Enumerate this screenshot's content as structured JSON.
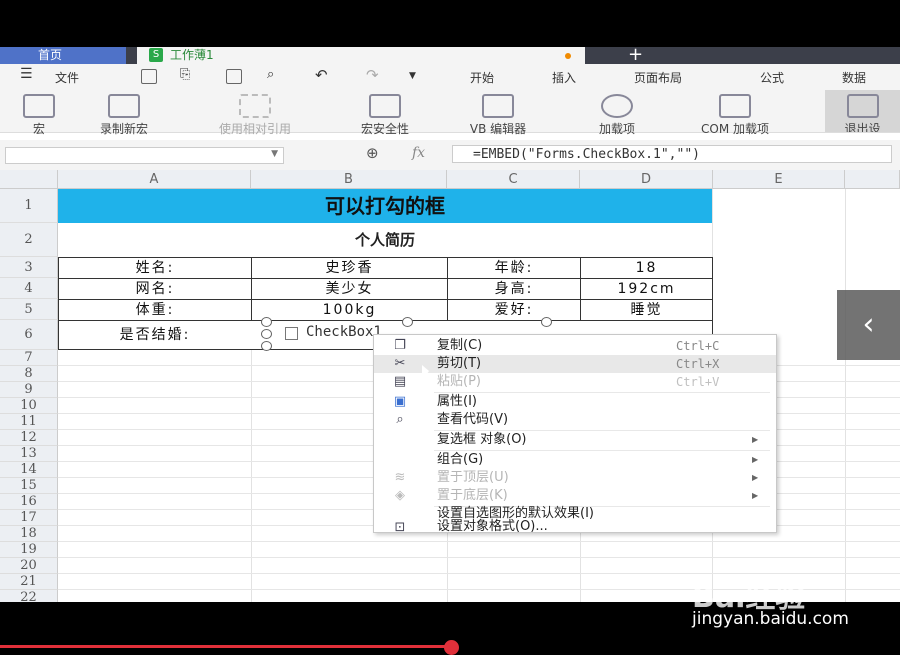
{
  "tabs": {
    "home": "首页",
    "doc_icon": "S",
    "doc": "工作薄1",
    "plus": "+"
  },
  "menu": {
    "file": "文件",
    "items": [
      "开始",
      "插入",
      "页面布局",
      "公式",
      "数据"
    ]
  },
  "ribbon": {
    "buttons": [
      "宏",
      "录制新宏",
      "使用相对引用",
      "宏安全性",
      "VB 编辑器",
      "加载项",
      "COM 加载项",
      "退出设"
    ]
  },
  "formula_bar": {
    "fx": "fx",
    "formula": "=EMBED(\"Forms.CheckBox.1\",\"\")"
  },
  "columns": [
    "A",
    "B",
    "C",
    "D",
    "E"
  ],
  "rows": [
    "1",
    "2",
    "3",
    "4",
    "5",
    "6",
    "7",
    "8",
    "9",
    "10",
    "11",
    "12",
    "13",
    "14",
    "15",
    "16",
    "17",
    "18",
    "19",
    "20",
    "21",
    "22"
  ],
  "sheet": {
    "title": "可以打勾的框",
    "subtitle": "个人简历",
    "r3": {
      "a": "姓名:",
      "b": "史珍香",
      "c": "年龄:",
      "d": "18"
    },
    "r4": {
      "a": "网名:",
      "b": "美少女",
      "c": "身高:",
      "d": "192cm"
    },
    "r5": {
      "a": "体重:",
      "b": "100kg",
      "c": "爱好:",
      "d": "睡觉"
    },
    "r6": {
      "a": "是否结婚:",
      "checkbox": "CheckBox1"
    }
  },
  "context_menu": {
    "copy": {
      "label": "复制(C)",
      "shortcut": "Ctrl+C"
    },
    "cut": {
      "label": "剪切(T)",
      "shortcut": "Ctrl+X"
    },
    "paste": {
      "label": "粘贴(P)",
      "shortcut": "Ctrl+V"
    },
    "properties": {
      "label": "属性(I)"
    },
    "view_code": {
      "label": "查看代码(V)"
    },
    "checkbox_object": {
      "label": "复选框 对象(O)"
    },
    "group": {
      "label": "组合(G)"
    },
    "bring_front": {
      "label": "置于顶层(U)"
    },
    "send_back": {
      "label": "置于底层(K)"
    },
    "set_default": {
      "label": "设置自选图形的默认效果(I)"
    },
    "format_object": {
      "label": "设置对象格式(O)..."
    }
  },
  "watermark": {
    "logo": "Bai经验",
    "url": "jingyan.baidu.com"
  },
  "colors": {
    "title_fill": "#1fb2ea",
    "tab_home": "#4f72c8",
    "progress": "#e0303a"
  }
}
